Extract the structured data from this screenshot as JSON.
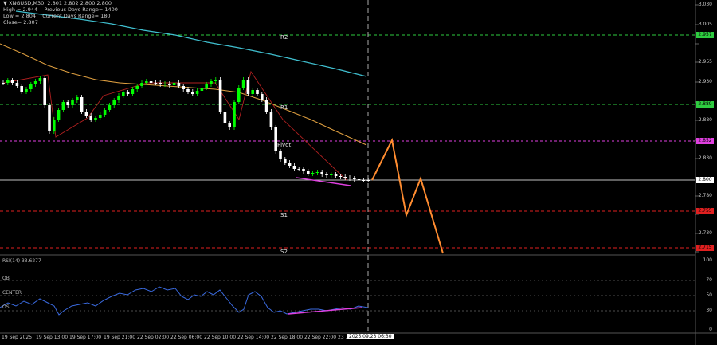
{
  "header": {
    "symbol_line": "▼ XNGUSD,M30  2.801 2.802 2.800 2.800",
    "high": "High = 2.944",
    "prev_range": "Previous Days Range= 1400",
    "low": "Low = 2.804",
    "curr_range": "Current Days Range= 180",
    "close": "Close= 2.807"
  },
  "levels": {
    "r2": {
      "label": "R2",
      "value": "2.957",
      "color": "#2ecc40"
    },
    "r1": {
      "label": "R1",
      "value": "2.889",
      "color": "#2ecc40"
    },
    "pivot": {
      "label": "Pivot",
      "value": "2.852",
      "color": "#e040e0"
    },
    "current": {
      "value": "2.800",
      "color": "#ffffff"
    },
    "s1": {
      "label": "S1",
      "value": "2.755",
      "color": "#e02020"
    },
    "s2": {
      "label": "S2",
      "value": "2.715",
      "color": "#e02020"
    }
  },
  "price_axis": [
    "3.030",
    "3.005",
    "2.980",
    "2.955",
    "2.930",
    "2.905",
    "2.880",
    "2.855",
    "2.830",
    "2.805",
    "2.780",
    "2.755",
    "2.730",
    "2.705"
  ],
  "rsi": {
    "title": "RSI(14) 33.6277",
    "ob": "OB",
    "center": "CENTER",
    "os": "OS",
    "axis": [
      "100",
      "70",
      "50",
      "30",
      "0"
    ]
  },
  "time_axis": [
    "19 Sep 2025",
    "19 Sep 13:00",
    "19 Sep 17:00",
    "19 Sep 21:00",
    "22 Sep 02:00",
    "22 Sep 06:00",
    "22 Sep 10:00",
    "22 Sep 14:00",
    "22 Sep 18:00",
    "22 Sep 22:00",
    "23 ..."
  ],
  "cursor_time": "2025.09.23 06:30",
  "colors": {
    "background": "#000000",
    "bull_candle": "#ffffff",
    "bear_candle": "#00ff00",
    "ma_fast": "#e0a040",
    "ma_slow": "#40c0d0",
    "projection": "#ff8c30",
    "rsi_line": "#3a6adf",
    "divergence": "#e040e0",
    "trendline": "#b02020"
  }
}
